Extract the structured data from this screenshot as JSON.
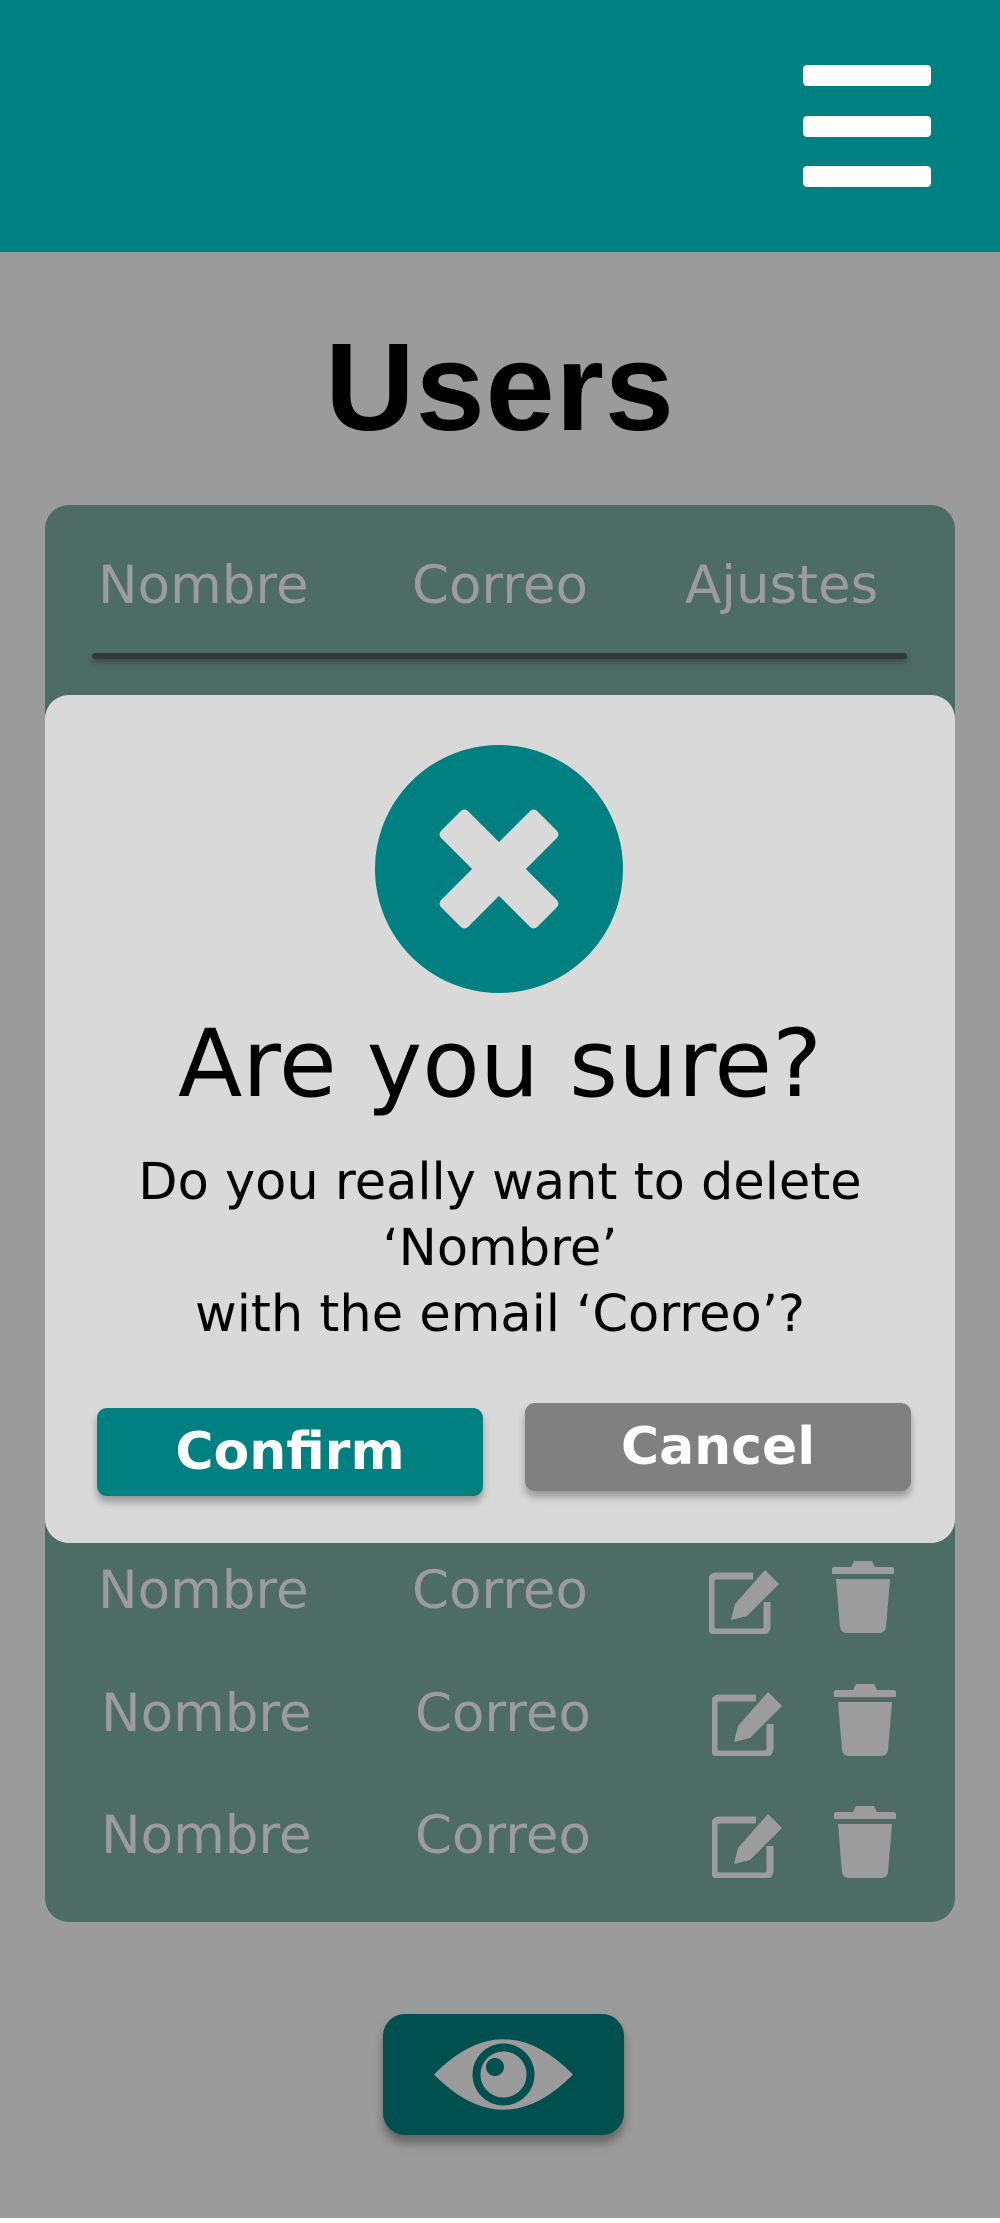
{
  "header": {
    "menu_icon": "hamburger-menu-icon",
    "color": "#008080"
  },
  "page": {
    "title": "Users"
  },
  "table": {
    "columns": [
      "Nombre",
      "Correo",
      "Ajustes"
    ],
    "rows": [
      {
        "name": "Nombre",
        "email": "Correo",
        "actions": [
          "edit-icon",
          "trash-icon"
        ]
      },
      {
        "name": "Nombre",
        "email": "Correo",
        "actions": [
          "edit-icon",
          "trash-icon"
        ]
      },
      {
        "name": "Nombre",
        "email": "Correo",
        "actions": [
          "edit-icon",
          "trash-icon"
        ]
      }
    ]
  },
  "dialog": {
    "icon": "close-circle-icon",
    "title": "Are you sure?",
    "message_line1": "Do you really want to delete",
    "message_line2": "‘Nombre’",
    "message_line3": "with the email ‘Correo’?",
    "confirm_label": "Confirm",
    "cancel_label": "Cancel"
  },
  "fab": {
    "icon": "eye-icon"
  },
  "colors": {
    "accent": "#008080",
    "overlay_bg": "#9b9b9b",
    "card_bg": "#4d6c64",
    "dialog_bg": "#d9d9d9",
    "cancel": "#808080",
    "fab": "#005050"
  }
}
